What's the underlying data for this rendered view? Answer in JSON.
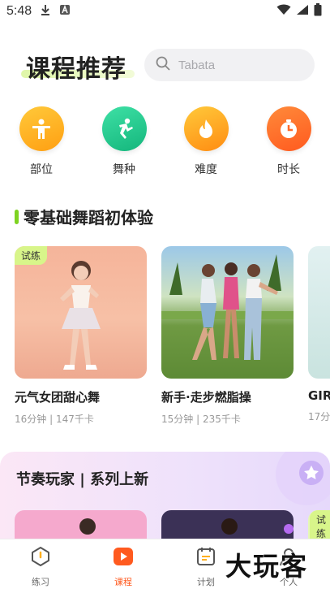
{
  "status_bar": {
    "time": "5:48"
  },
  "header": {
    "title": "课程推荐",
    "search_placeholder": "Tabata"
  },
  "categories": [
    {
      "label": "部位",
      "icon": "body-icon",
      "color": "#ffb01f"
    },
    {
      "label": "舞种",
      "icon": "dance-icon",
      "color": "#22c98e"
    },
    {
      "label": "难度",
      "icon": "flame-icon",
      "color": "#ffa222"
    },
    {
      "label": "时长",
      "icon": "clock-icon",
      "color": "#ff6a2a"
    }
  ],
  "section": {
    "title": "零基础舞蹈初体验"
  },
  "courses": [
    {
      "name": "元气女团甜心舞",
      "meta": "16分钟 | 147千卡",
      "tag": "试练"
    },
    {
      "name": "新手·走步燃脂操",
      "meta": "15分钟 | 235千卡"
    },
    {
      "name": "GIRL",
      "meta": "17分"
    }
  ],
  "series": {
    "title": "节奏玩家 | 系列上新",
    "tag": "试练"
  },
  "tabbar": [
    {
      "label": "练习",
      "icon": "practice-icon"
    },
    {
      "label": "课程",
      "icon": "course-icon",
      "active": true
    },
    {
      "label": "计划",
      "icon": "plan-icon"
    },
    {
      "label": "个人",
      "icon": "profile-icon"
    }
  ],
  "watermark": "大玩客"
}
